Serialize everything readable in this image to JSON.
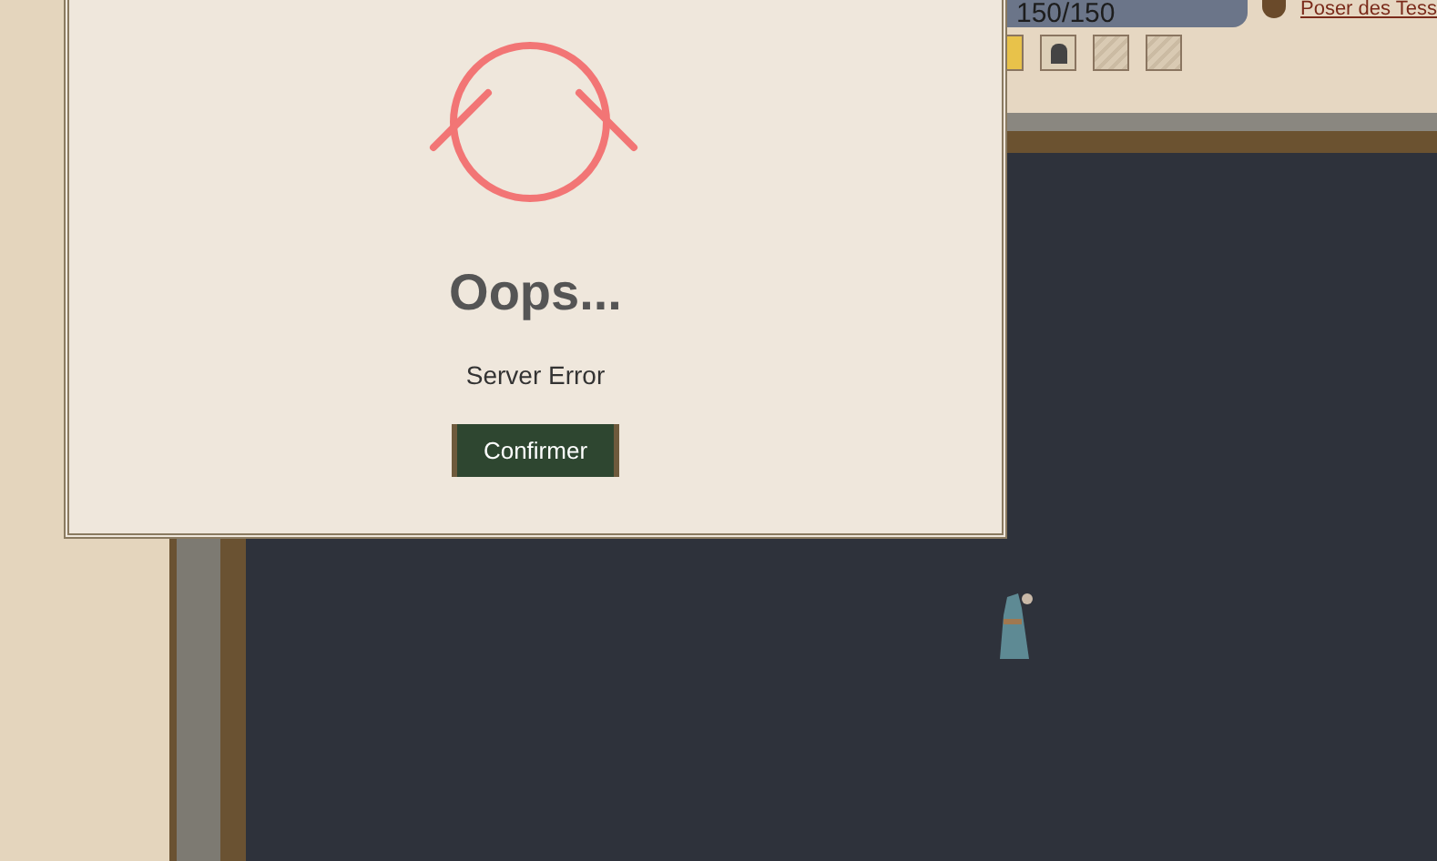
{
  "background": {
    "health": "150/150",
    "link": "Poser des Tess"
  },
  "dialog": {
    "title": "Oops...",
    "message": "Server Error",
    "button": "Confirmer"
  }
}
